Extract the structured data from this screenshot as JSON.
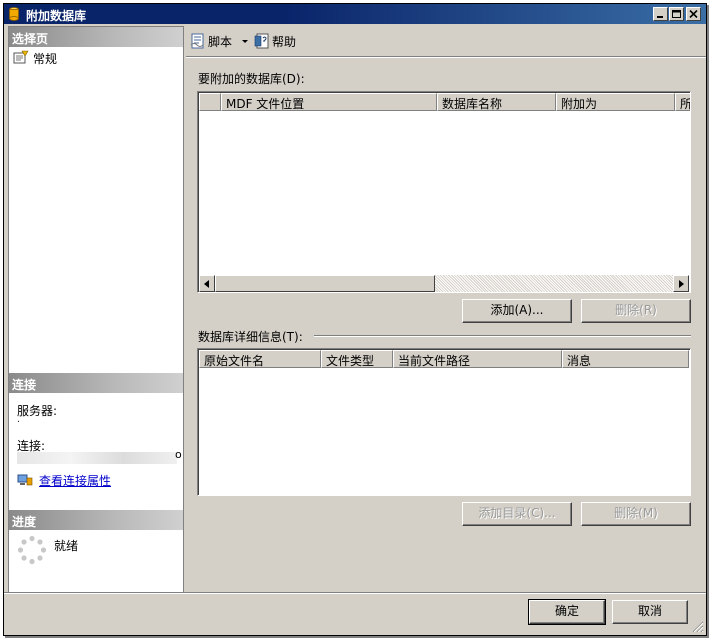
{
  "window": {
    "title": "附加数据库"
  },
  "left_panel": {
    "select_page_header": "选择页",
    "pages": [
      {
        "label": "常规"
      }
    ],
    "connection_header": "连接",
    "server_label": "服务器:",
    "server_value": ".",
    "connection_label": "连接:",
    "view_connection_link": "查看连接属性",
    "progress_header": "进度",
    "progress_status": "就绪"
  },
  "toolbar": {
    "script_label": "脚本",
    "help_label": "帮助"
  },
  "databases_section": {
    "label": "要附加的数据库(D):",
    "columns": [
      "",
      "MDF 文件位置",
      "数据库名称",
      "附加为",
      "所"
    ],
    "add_button": "添加(A)...",
    "remove_button": "删除(R)"
  },
  "details_section": {
    "label": "数据库详细信息(T):",
    "columns": [
      "原始文件名",
      "文件类型",
      "当前文件路径",
      "消息"
    ],
    "add_catalog_button": "添加目录(C)...",
    "remove_button": "删除(M)"
  },
  "footer": {
    "ok_button": "确定",
    "cancel_button": "取消"
  },
  "colors": {
    "title_bar": "#0a246a",
    "dialog_face": "#d4d0c8",
    "link": "#0000cc"
  }
}
